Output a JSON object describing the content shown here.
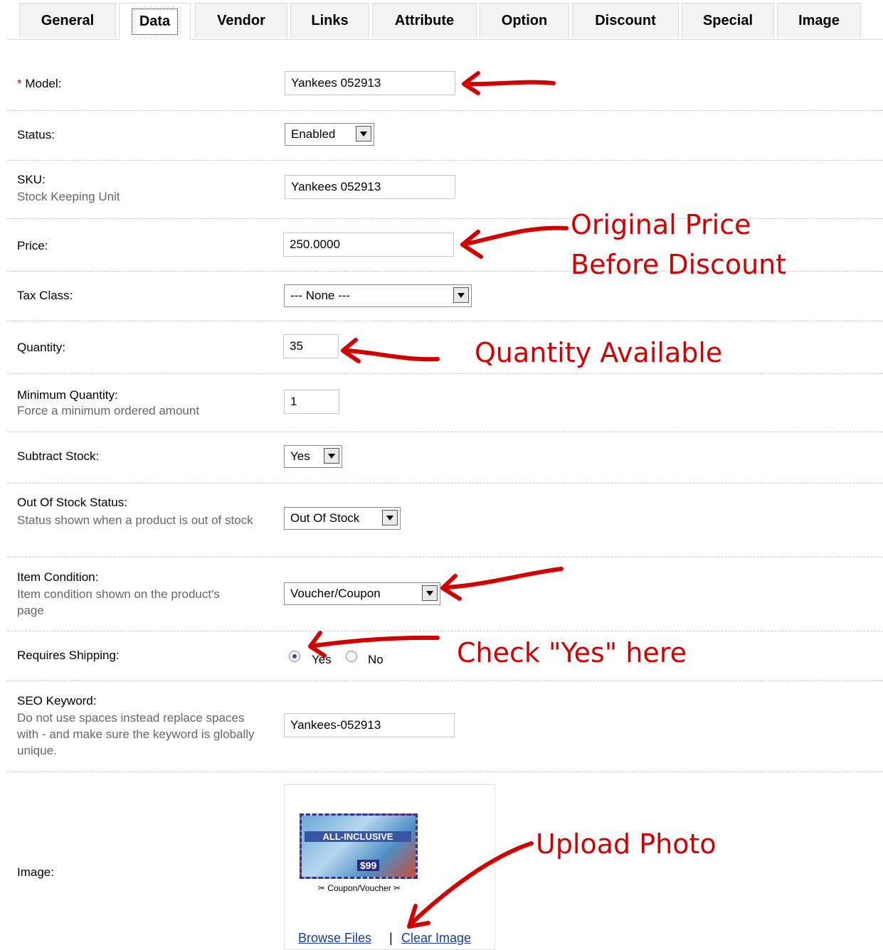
{
  "tabs": [
    "General",
    "Data",
    "Vendor",
    "Links",
    "Attribute",
    "Option",
    "Discount",
    "Special",
    "Image"
  ],
  "form": {
    "model": {
      "required_mark": "*",
      "label": "Model:",
      "value": "Yankees 052913"
    },
    "status": {
      "label": "Status:",
      "value": "Enabled"
    },
    "sku": {
      "label": "SKU:",
      "help": "Stock Keeping Unit",
      "value": "Yankees 052913"
    },
    "price": {
      "label": "Price:",
      "value": "250.0000"
    },
    "tax_class": {
      "label": "Tax Class:",
      "value": "--- None ---"
    },
    "quantity": {
      "label": "Quantity:",
      "value": "35"
    },
    "minimum_quantity": {
      "label": "Minimum Quantity:",
      "help": "Force a minimum ordered amount",
      "value": "1"
    },
    "subtract_stock": {
      "label": "Subtract Stock:",
      "value": "Yes"
    },
    "out_of_stock_status": {
      "label": "Out Of Stock Status:",
      "help": "Status shown when a product is out of stock",
      "value": "Out Of Stock"
    },
    "item_condition": {
      "label": "Item Condition:",
      "help": "Item condition shown on the product's page",
      "value": "Voucher/Coupon"
    },
    "requires_shipping": {
      "label": "Requires Shipping:",
      "yes": "Yes",
      "no": "No",
      "selected": "Yes"
    },
    "seo_keyword": {
      "label": "SEO Keyword:",
      "help": "Do not use spaces instead replace spaces with - and make sure the keyword is globally unique.",
      "value": "Yankees-052913"
    },
    "image": {
      "label": "Image:",
      "thumbnail_title": "ALL-INCLUSIVE",
      "thumbnail_price": "$99",
      "thumbnail_caption": "Coupon/Voucher",
      "browse": "Browse Files",
      "separator": "|",
      "clear": "Clear Image"
    }
  },
  "annotations": {
    "price_note_line1": "Original Price",
    "price_note_line2": "Before Discount",
    "quantity_note": "Quantity Available",
    "shipping_note": "Check \"Yes\" here",
    "image_note": "Upload Photo",
    "color": "#d10000"
  }
}
